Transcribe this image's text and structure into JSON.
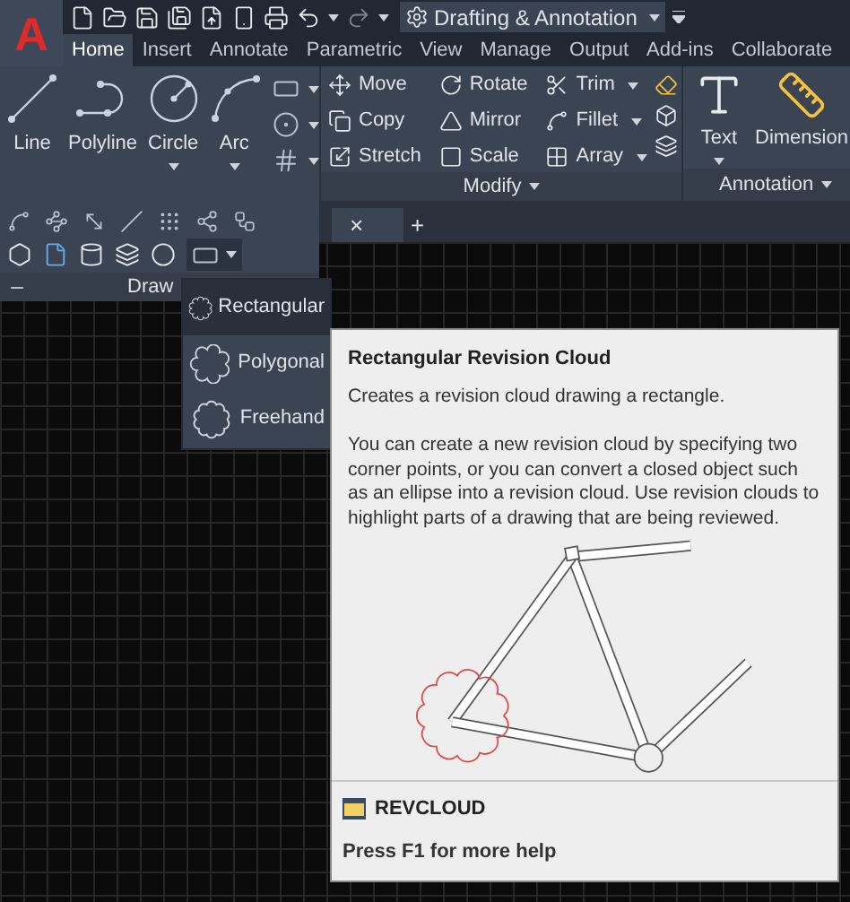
{
  "app_button": {
    "label": "A"
  },
  "workspace": {
    "label": "Drafting & Annotation"
  },
  "tabs": [
    {
      "label": "Home",
      "selected": true
    },
    {
      "label": "Insert",
      "selected": false
    },
    {
      "label": "Annotate",
      "selected": false
    },
    {
      "label": "Parametric",
      "selected": false
    },
    {
      "label": "View",
      "selected": false
    },
    {
      "label": "Manage",
      "selected": false
    },
    {
      "label": "Output",
      "selected": false
    },
    {
      "label": "Add-ins",
      "selected": false
    },
    {
      "label": "Collaborate",
      "selected": false
    }
  ],
  "draw_panel": {
    "label": "Draw",
    "tools": [
      {
        "label": "Line",
        "dropdown": false
      },
      {
        "label": "Polyline",
        "dropdown": false
      },
      {
        "label": "Circle",
        "dropdown": true
      },
      {
        "label": "Arc",
        "dropdown": true
      }
    ]
  },
  "modify_panel": {
    "label": "Modify",
    "tools": [
      {
        "label": "Move",
        "dropdown": false
      },
      {
        "label": "Rotate",
        "dropdown": false
      },
      {
        "label": "Trim",
        "dropdown": true
      },
      {
        "label": "Copy",
        "dropdown": false
      },
      {
        "label": "Mirror",
        "dropdown": false
      },
      {
        "label": "Fillet",
        "dropdown": true
      },
      {
        "label": "Stretch",
        "dropdown": false
      },
      {
        "label": "Scale",
        "dropdown": false
      },
      {
        "label": "Array",
        "dropdown": true
      }
    ]
  },
  "annotation_panel": {
    "label": "Annotation",
    "tools": [
      {
        "label": "Text",
        "dropdown": true
      },
      {
        "label": "Dimension",
        "dropdown": false
      }
    ]
  },
  "document_tabs": {
    "close": "×",
    "add": "+"
  },
  "revcloud_menu": {
    "items": [
      {
        "label": "Rectangular",
        "selected": true
      },
      {
        "label": "Polygonal",
        "selected": false
      },
      {
        "label": "Freehand",
        "selected": false
      }
    ]
  },
  "tooltip": {
    "title": "Rectangular Revision Cloud",
    "summary": "Creates a revision cloud drawing a rectangle.",
    "details": "You can create a new revision cloud by specifying two corner points, or you can convert a closed object such as an ellipse into a revision cloud. Use revision clouds to highlight parts of a drawing that are being reviewed.",
    "command": "REVCLOUD",
    "help": "Press F1 for more help"
  }
}
